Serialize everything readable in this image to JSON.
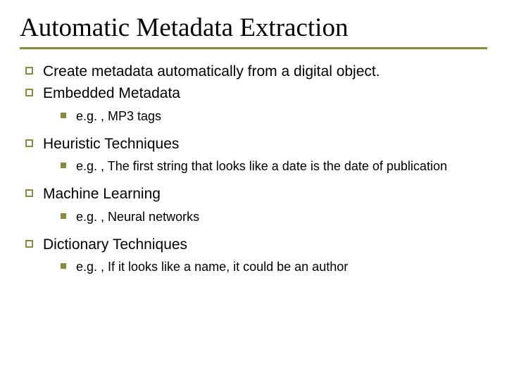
{
  "title": "Automatic Metadata Extraction",
  "items": [
    {
      "level": 1,
      "text": "Create metadata automatically from a digital object."
    },
    {
      "level": 1,
      "text": "Embedded Metadata"
    },
    {
      "level": 2,
      "text": "e.g. , MP3 tags"
    },
    {
      "level": 1,
      "text": "Heuristic Techniques"
    },
    {
      "level": 2,
      "text": "e.g. , The first string that looks like a date is the date of publication"
    },
    {
      "level": 1,
      "text": "Machine Learning"
    },
    {
      "level": 2,
      "text": "e.g. , Neural networks"
    },
    {
      "level": 1,
      "text": "Dictionary Techniques"
    },
    {
      "level": 2,
      "text": "e.g. , If it looks like a name, it could be an author"
    }
  ]
}
